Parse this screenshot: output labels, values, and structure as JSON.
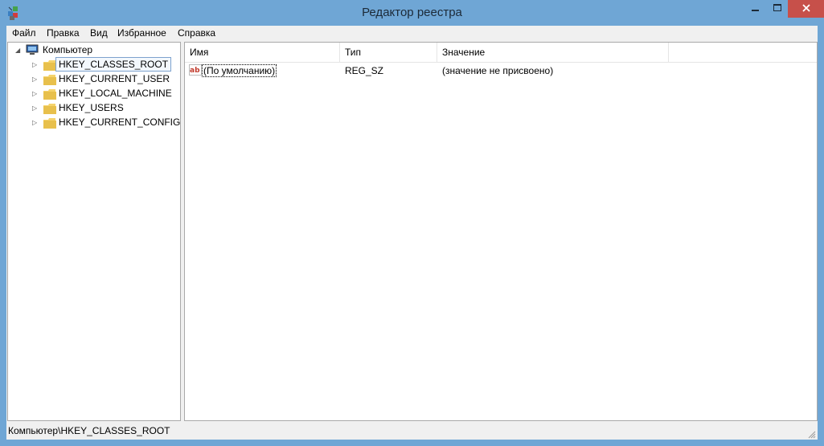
{
  "window": {
    "title": "Редактор реестра"
  },
  "menu": {
    "items": [
      "Файл",
      "Правка",
      "Вид",
      "Избранное",
      "Справка"
    ]
  },
  "tree": {
    "root": "Компьютер",
    "children": [
      "HKEY_CLASSES_ROOT",
      "HKEY_CURRENT_USER",
      "HKEY_LOCAL_MACHINE",
      "HKEY_USERS",
      "HKEY_CURRENT_CONFIG"
    ],
    "selected": "HKEY_CLASSES_ROOT"
  },
  "list": {
    "columns": [
      "Имя",
      "Тип",
      "Значение"
    ],
    "rows": [
      {
        "name": "(По умолчанию)",
        "type": "REG_SZ",
        "value": "(значение не присвоено)"
      }
    ]
  },
  "status": {
    "path": "Компьютер\\HKEY_CLASSES_ROOT"
  },
  "colors": {
    "frame": "#6fa6d5",
    "close_button": "#c7504a",
    "selection_border": "#7da2ce"
  },
  "icons": {
    "app": "registry-editor-icon",
    "computer": "computer-icon",
    "folder": "folder-icon",
    "value": "string-value-icon"
  }
}
